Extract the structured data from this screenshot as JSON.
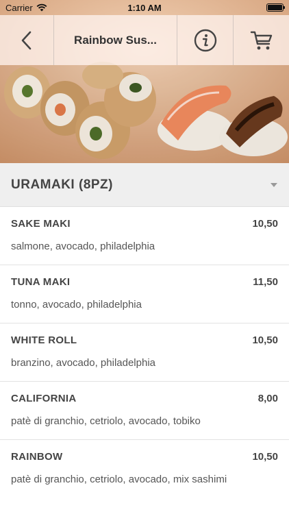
{
  "status_bar": {
    "carrier": "Carrier",
    "time": "1:10 AM",
    "battery_level": 1.0
  },
  "nav": {
    "title": "Rainbow Sus...",
    "back_icon": "chevron-left-icon",
    "info_icon": "info-circle-icon",
    "cart_icon": "cart-icon"
  },
  "category": {
    "title": "URAMAKI (8PZ)",
    "toggle_icon": "caret-down-icon"
  },
  "items": [
    {
      "name": "SAKE MAKI",
      "price": "10,50",
      "description": "salmone, avocado, philadelphia"
    },
    {
      "name": "TUNA MAKI",
      "price": "11,50",
      "description": "tonno, avocado, philadelphia"
    },
    {
      "name": "WHITE ROLL",
      "price": "10,50",
      "description": "branzino, avocado, philadelphia"
    },
    {
      "name": "CALIFORNIA",
      "price": "8,00",
      "description": "patè di granchio, cetriolo, avocado, tobiko"
    },
    {
      "name": "RAINBOW",
      "price": "10,50",
      "description": "patè di granchio, cetriolo, avocado, mix sashimi"
    }
  ],
  "colors": {
    "nav_overlay": "#fff5f2",
    "category_bg": "#efefef",
    "text": "#444444"
  }
}
